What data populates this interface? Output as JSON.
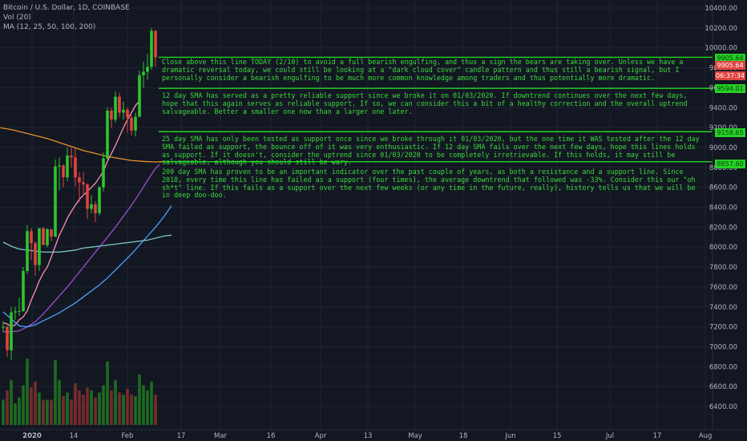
{
  "legend": {
    "symbol": "Bitcoin / U.S. Dollar, 1D, COINBASE",
    "volume": "Vol (20)",
    "ma": "MA (12, 25, 50, 100, 200)"
  },
  "colors": {
    "background": "#131722",
    "grid": "#1f2433",
    "axis_text": "#b2b5be",
    "bull": "#26a69a",
    "bull_candle": "#2ec52e",
    "bear": "#e0443f",
    "annotation": "#3bd93b",
    "ma12": "#ff8fb3",
    "ma25": "#9c4fd1",
    "ma50": "#4aa3ff",
    "ma100": "#7ec3c5",
    "ma200": "#e6902b"
  },
  "annotations": [
    {
      "text": "Close above this line TODAY (2/10) to avoid a full bearish engulfing, and thus a sign the bears are taking over. Unless we have a dramatic reversal today, we could still be looking at a \"dark cloud cover\" candle pattern and thus still a bearish signal, but I personally consider a bearish engulfing to be much more common knowledge among traders and thus potentially more dramatic."
    },
    {
      "text": "12 day SMA has served as a pretty reliable support since we broke it on 01/03/2020. If downtrend continues over the next few days, hope that this again serves as reliable support. If so, we can consider this a bit of a healthy correction and the overall uptrend salvageable. Better a smaller one now than a larger one later."
    },
    {
      "text": "25 day SMA has only been tested as support once since we broke through it 01/03/2020, but the one time it WAS tested after the 12 day SMA failed as support, the bounce off of it was very enthusiastic. If 12 day SMA fails over the next few days, hope this lines holds as support. If it doesn't, consider the uptrend since 01/03/2020 to be completely irretrievable. If this holds, it may still be salvageable, although you should still be wary."
    },
    {
      "text": "200 day SMA has proven to be an important indicator over the past couple of years, as both a resistance and a support line. Since 2018, every time this line has failed as a support (four times), the average downtrend that followed was -33%. Consider this our \"oh sh*t\" line. If this fails as a support over the next few weeks (or any time in the future, really), history tells us that we will be in deep doo-doo."
    }
  ],
  "price_tags": [
    {
      "label": "9905.64",
      "value": 9905.64,
      "style": "green"
    },
    {
      "label": "9905.64",
      "value": 9905.64,
      "style": "red"
    },
    {
      "label": "06:37:34",
      "value": 9755,
      "style": "red2"
    },
    {
      "label": "9594.01",
      "value": 9594.01,
      "style": "green"
    },
    {
      "label": "9158.65",
      "value": 9158.65,
      "style": "green"
    },
    {
      "label": "8857.60",
      "value": 8857.6,
      "style": "green"
    }
  ],
  "chart_data": {
    "type": "candlestick",
    "title": "Bitcoin / U.S. Dollar, 1D, COINBASE",
    "x_ticks": [
      "2020",
      "14",
      "Feb",
      "17",
      "Mar",
      "16",
      "Apr",
      "13",
      "May",
      "18",
      "Jun",
      "15",
      "Jul",
      "17",
      "Aug"
    ],
    "y_ticks": [
      6400,
      6600,
      6800,
      7000,
      7200,
      7400,
      7600,
      7800,
      8000,
      8200,
      8400,
      8600,
      8800,
      9000,
      9200,
      9400,
      9600,
      9800,
      10000,
      10200,
      10400
    ],
    "ylim": [
      6300,
      10500
    ],
    "horizontal_lines": [
      9905.64,
      9594.01,
      9158.65,
      8857.6
    ],
    "candles": [
      {
        "o": 7195,
        "h": 7255,
        "l": 7150,
        "c": 7200
      },
      {
        "o": 7200,
        "h": 7212,
        "l": 6900,
        "c": 6965
      },
      {
        "o": 6965,
        "h": 7400,
        "l": 6870,
        "c": 7345
      },
      {
        "o": 7345,
        "h": 7400,
        "l": 7270,
        "c": 7355
      },
      {
        "o": 7355,
        "h": 7495,
        "l": 7310,
        "c": 7358
      },
      {
        "o": 7358,
        "h": 7800,
        "l": 7350,
        "c": 7760
      },
      {
        "o": 7760,
        "h": 8220,
        "l": 7730,
        "c": 8160
      },
      {
        "o": 8160,
        "h": 8190,
        "l": 7870,
        "c": 8040
      },
      {
        "o": 8040,
        "h": 8060,
        "l": 7710,
        "c": 7820
      },
      {
        "o": 7820,
        "h": 8100,
        "l": 7760,
        "c": 8190
      },
      {
        "o": 8190,
        "h": 8200,
        "l": 8030,
        "c": 8020
      },
      {
        "o": 8020,
        "h": 8190,
        "l": 8000,
        "c": 8180
      },
      {
        "o": 8180,
        "h": 8180,
        "l": 8060,
        "c": 8105
      },
      {
        "o": 8105,
        "h": 8880,
        "l": 8100,
        "c": 8810
      },
      {
        "o": 8810,
        "h": 8900,
        "l": 8570,
        "c": 8820
      },
      {
        "o": 8820,
        "h": 8830,
        "l": 8600,
        "c": 8700
      },
      {
        "o": 8700,
        "h": 9000,
        "l": 8660,
        "c": 8920
      },
      {
        "o": 8920,
        "h": 9000,
        "l": 8800,
        "c": 8900
      },
      {
        "o": 8900,
        "h": 8990,
        "l": 8610,
        "c": 8700
      },
      {
        "o": 8700,
        "h": 8750,
        "l": 8450,
        "c": 8650
      },
      {
        "o": 8650,
        "h": 8750,
        "l": 8520,
        "c": 8630
      },
      {
        "o": 8630,
        "h": 8640,
        "l": 8280,
        "c": 8385
      },
      {
        "o": 8385,
        "h": 8520,
        "l": 8340,
        "c": 8430
      },
      {
        "o": 8430,
        "h": 8460,
        "l": 8250,
        "c": 8340
      },
      {
        "o": 8340,
        "h": 8615,
        "l": 8320,
        "c": 8600
      },
      {
        "o": 8600,
        "h": 8950,
        "l": 8560,
        "c": 8890
      },
      {
        "o": 8890,
        "h": 9400,
        "l": 8880,
        "c": 9370
      },
      {
        "o": 9370,
        "h": 9400,
        "l": 9200,
        "c": 9280
      },
      {
        "o": 9280,
        "h": 9560,
        "l": 9250,
        "c": 9510
      },
      {
        "o": 9510,
        "h": 9550,
        "l": 9300,
        "c": 9350
      },
      {
        "o": 9350,
        "h": 9460,
        "l": 9280,
        "c": 9380
      },
      {
        "o": 9380,
        "h": 9400,
        "l": 9150,
        "c": 9300
      },
      {
        "o": 9300,
        "h": 9330,
        "l": 9120,
        "c": 9170
      },
      {
        "o": 9170,
        "h": 9350,
        "l": 9110,
        "c": 9310
      },
      {
        "o": 9310,
        "h": 9770,
        "l": 9300,
        "c": 9725
      },
      {
        "o": 9725,
        "h": 9860,
        "l": 9600,
        "c": 9760
      },
      {
        "o": 9760,
        "h": 9940,
        "l": 9680,
        "c": 9810
      },
      {
        "o": 9810,
        "h": 10200,
        "l": 9780,
        "c": 10170
      },
      {
        "o": 10170,
        "h": 10180,
        "l": 9810,
        "c": 9905
      }
    ],
    "volumes": [
      0.35,
      0.48,
      0.62,
      0.3,
      0.38,
      0.55,
      0.92,
      0.52,
      0.6,
      0.45,
      0.35,
      0.35,
      0.35,
      0.9,
      0.62,
      0.4,
      0.45,
      0.35,
      0.58,
      0.48,
      0.42,
      0.52,
      0.48,
      0.38,
      0.45,
      0.55,
      0.88,
      0.48,
      0.62,
      0.45,
      0.42,
      0.5,
      0.42,
      0.4,
      0.7,
      0.55,
      0.48,
      0.6,
      0.42
    ],
    "ma_lines": [
      {
        "name": "MA 12",
        "color": "#ff8fb3",
        "points": [
          [
            0,
            7240
          ],
          [
            1,
            7230
          ],
          [
            2,
            7200
          ],
          [
            3,
            7220
          ],
          [
            4,
            7270
          ],
          [
            5,
            7300
          ],
          [
            6,
            7360
          ],
          [
            7,
            7470
          ],
          [
            8,
            7560
          ],
          [
            9,
            7660
          ],
          [
            10,
            7740
          ],
          [
            11,
            7800
          ],
          [
            12,
            7900
          ],
          [
            13,
            8010
          ],
          [
            14,
            8120
          ],
          [
            15,
            8200
          ],
          [
            16,
            8290
          ],
          [
            17,
            8360
          ],
          [
            18,
            8420
          ],
          [
            19,
            8480
          ],
          [
            20,
            8520
          ],
          [
            21,
            8560
          ],
          [
            22,
            8600
          ],
          [
            23,
            8640
          ],
          [
            24,
            8700
          ],
          [
            25,
            8760
          ],
          [
            26,
            8860
          ],
          [
            27,
            8940
          ],
          [
            28,
            9020
          ],
          [
            29,
            9110
          ],
          [
            30,
            9200
          ],
          [
            31,
            9280
          ],
          [
            32,
            9350
          ],
          [
            33,
            9420
          ],
          [
            34,
            9470
          ]
        ]
      },
      {
        "name": "MA 25",
        "color": "#9c4fd1",
        "points": [
          [
            0,
            7150
          ],
          [
            2,
            7150
          ],
          [
            4,
            7160
          ],
          [
            6,
            7200
          ],
          [
            8,
            7250
          ],
          [
            10,
            7330
          ],
          [
            12,
            7420
          ],
          [
            14,
            7510
          ],
          [
            16,
            7600
          ],
          [
            18,
            7700
          ],
          [
            20,
            7800
          ],
          [
            22,
            7900
          ],
          [
            24,
            8000
          ],
          [
            26,
            8100
          ],
          [
            28,
            8200
          ],
          [
            30,
            8310
          ],
          [
            32,
            8420
          ],
          [
            34,
            8540
          ],
          [
            36,
            8670
          ],
          [
            38,
            8790
          ],
          [
            39,
            8830
          ]
        ]
      },
      {
        "name": "MA 50",
        "color": "#4aa3ff",
        "points": [
          [
            0,
            7350
          ],
          [
            2,
            7280
          ],
          [
            4,
            7210
          ],
          [
            6,
            7200
          ],
          [
            8,
            7220
          ],
          [
            10,
            7260
          ],
          [
            12,
            7300
          ],
          [
            14,
            7340
          ],
          [
            16,
            7390
          ],
          [
            18,
            7440
          ],
          [
            20,
            7500
          ],
          [
            22,
            7560
          ],
          [
            24,
            7620
          ],
          [
            26,
            7690
          ],
          [
            28,
            7770
          ],
          [
            30,
            7850
          ],
          [
            32,
            7930
          ],
          [
            34,
            8020
          ],
          [
            36,
            8110
          ],
          [
            38,
            8200
          ],
          [
            40,
            8300
          ],
          [
            42,
            8415
          ]
        ]
      },
      {
        "name": "MA 100",
        "color": "#7ec3c5",
        "points": [
          [
            0,
            8050
          ],
          [
            2,
            8010
          ],
          [
            4,
            7980
          ],
          [
            6,
            7970
          ],
          [
            8,
            7960
          ],
          [
            10,
            7950
          ],
          [
            12,
            7950
          ],
          [
            14,
            7950
          ],
          [
            16,
            7960
          ],
          [
            18,
            7970
          ],
          [
            20,
            7990
          ],
          [
            22,
            8000
          ],
          [
            24,
            8010
          ],
          [
            26,
            8020
          ],
          [
            28,
            8030
          ],
          [
            30,
            8040
          ],
          [
            32,
            8050
          ],
          [
            34,
            8060
          ],
          [
            36,
            8070
          ],
          [
            38,
            8090
          ],
          [
            40,
            8110
          ],
          [
            42,
            8120
          ]
        ]
      },
      {
        "name": "MA 200",
        "color": "#e6902b",
        "points": [
          [
            -13,
            9300
          ],
          [
            -10,
            9270
          ],
          [
            -7,
            9250
          ],
          [
            -4,
            9220
          ],
          [
            -1,
            9200
          ],
          [
            2,
            9180
          ],
          [
            5,
            9150
          ],
          [
            8,
            9120
          ],
          [
            11,
            9090
          ],
          [
            14,
            9050
          ],
          [
            17,
            9010
          ],
          [
            20,
            8970
          ],
          [
            23,
            8940
          ],
          [
            26,
            8910
          ],
          [
            29,
            8890
          ],
          [
            32,
            8870
          ],
          [
            35,
            8860
          ],
          [
            38,
            8855
          ],
          [
            40,
            8857
          ]
        ]
      }
    ]
  }
}
